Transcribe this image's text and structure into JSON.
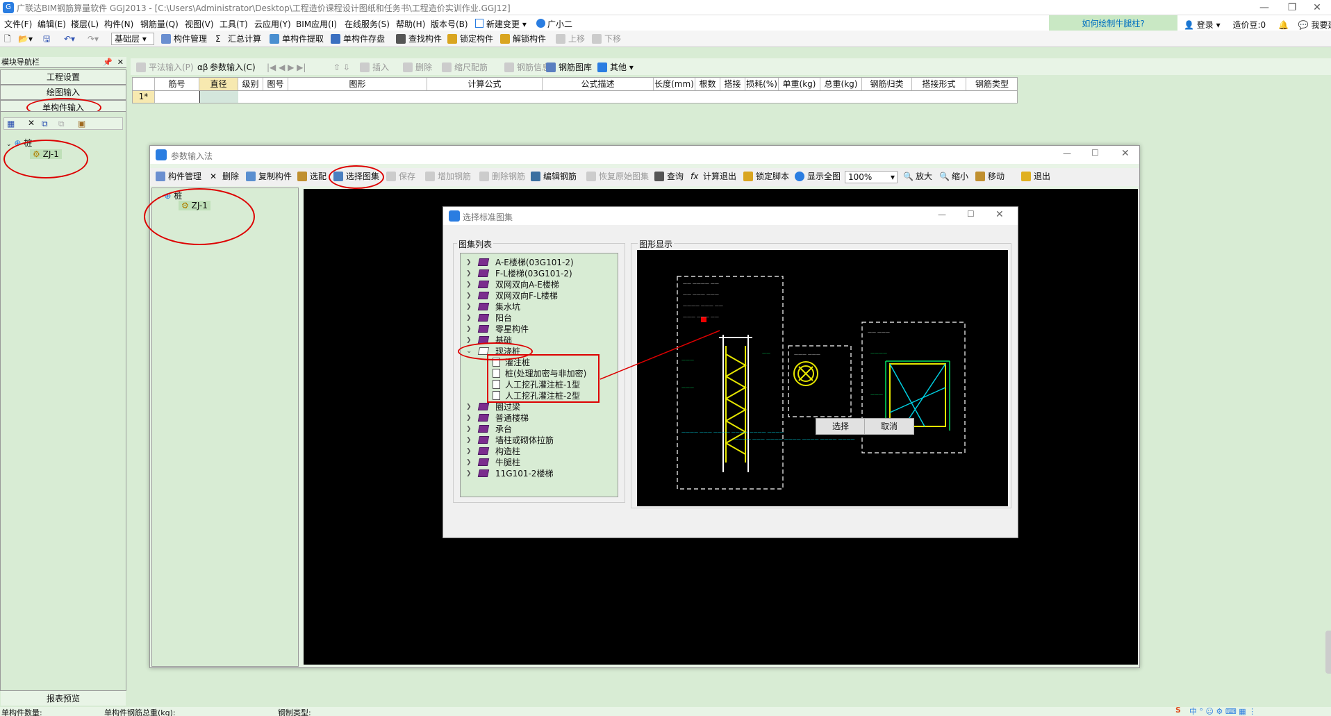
{
  "window": {
    "title": "广联达BIM钢筋算量软件 GGJ2013 - [C:\\Users\\Administrator\\Desktop\\工程造价课程设计图纸和任务书\\工程造价实训作业.GGJ12]"
  },
  "menu": [
    "文件(F)",
    "编辑(E)",
    "楼层(L)",
    "构件(N)",
    "钢筋量(Q)",
    "视图(V)",
    "工具(T)",
    "云应用(Y)",
    "BIM应用(I)",
    "在线服务(S)",
    "帮助(H)",
    "版本号(B)",
    "新建变更",
    "广小二"
  ],
  "help_link": "如何绘制牛腿柱?",
  "account": {
    "login": "登录",
    "beans": "造价豆:0",
    "suggest": "我要建议"
  },
  "toolbar": {
    "floor": "基础层",
    "component_mgmt": "构件管理",
    "sum_calc": "汇总计算",
    "single_extract": "单构件提取",
    "single_save": "单构件存盘",
    "find": "查找构件",
    "lock": "锁定构件",
    "unlock": "解锁构件",
    "up": "上移",
    "down": "下移"
  },
  "nav": {
    "title": "模块导航栏",
    "btn_project": "工程设置",
    "btn_draw": "绘图输入",
    "btn_single": "单构件输入",
    "tree_root": "桩",
    "tree_child": "ZJ-1",
    "report": "报表预览"
  },
  "toolbar2": {
    "flat_input": "平法输入(P)",
    "param_input": "参数输入(C)",
    "insert": "插入",
    "delete": "删除",
    "scale": "缩尺配筋",
    "rebar_info": "钢筋信息",
    "rebar_lib": "钢筋图库",
    "other": "其他"
  },
  "grid": {
    "headers": [
      "筋号",
      "直径(mm)",
      "级别",
      "图号",
      "图形",
      "计算公式",
      "公式描述",
      "长度(mm)",
      "根数",
      "搭接",
      "损耗(%)",
      "单重(kg)",
      "总重(kg)",
      "钢筋归类",
      "搭接形式",
      "钢筋类型"
    ],
    "row1": "1*"
  },
  "param_dialog": {
    "title": "参数输入法",
    "toolbar": [
      "构件管理",
      "删除",
      "复制构件",
      "选配",
      "选择图集",
      "保存",
      "增加钢筋",
      "删除钢筋",
      "编辑钢筋",
      "恢复原始图集",
      "查询",
      "计算退出",
      "锁定脚本",
      "显示全图",
      "放大",
      "缩小",
      "移动",
      "退出"
    ],
    "zoom": "100%",
    "tree_root": "桩",
    "tree_child": "ZJ-1"
  },
  "atlas_dialog": {
    "title": "选择标准图集",
    "list_label": "图集列表",
    "preview_label": "图形显示",
    "items": [
      "A-E楼梯(03G101-2)",
      "F-L楼梯(03G101-2)",
      "双网双向A-E楼梯",
      "双网双向F-L楼梯",
      "集水坑",
      "阳台",
      "零星构件",
      "基础",
      "现浇桩",
      "灌注桩",
      "桩(处理加密与非加密)",
      "人工挖孔灌注桩-1型",
      "人工挖孔灌注桩-2型",
      "圈过梁",
      "普通楼梯",
      "承台",
      "墙柱或砌体拉筋",
      "构造柱",
      "牛腿柱",
      "11G101-2楼梯"
    ],
    "select": "选择",
    "cancel": "取消"
  },
  "status": {
    "count": "单构件数量:",
    "weight": "单构件钢筋总重(kg):",
    "type": "钢制类型:"
  },
  "colors": {
    "accent": "#2a7de1",
    "panel": "#d8ecd4",
    "annotation": "#dd0000"
  }
}
